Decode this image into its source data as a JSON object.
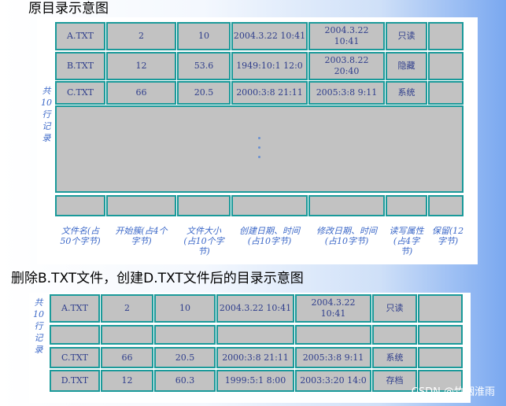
{
  "title_top": "原目录示意图",
  "title_bottom": "删除B.TXT文件，创建D.TXT文件后的目录示意图",
  "record_count_label": "共\n10\n行\n记\n录",
  "table1": {
    "rows": [
      [
        "A.TXT",
        "2",
        "10",
        "2004.3.22 10:41",
        "2004.3.22\n10:41",
        "只读",
        ""
      ],
      [
        "B.TXT",
        "12",
        "53.6",
        "1949:10:1 12:0",
        "2003.8.22\n20:40",
        "隐藏",
        ""
      ],
      [
        "C.TXT",
        "66",
        "20.5",
        "2000:3:8 21:11",
        "2005:3:8 9:11",
        "系统",
        ""
      ]
    ],
    "ellipsis": "…",
    "empty_row": [
      "",
      "",
      "",
      "",
      "",
      "",
      ""
    ],
    "captions": [
      "文件名(占\n50个字节)",
      "开始簇(占4个\n字节)",
      "文件大小\n(占10个字\n节)",
      "创建日期、时间\n(占10字节)",
      "修改日期、时间\n(占10字节)",
      "读写属性\n(占4字\n节)",
      "保留(12\n字节)"
    ]
  },
  "table2": {
    "rows": [
      [
        "A.TXT",
        "2",
        "10",
        "2004.3.22 10:41",
        "2004.3.22\n10:41",
        "只读",
        ""
      ],
      [
        "",
        "",
        "",
        "",
        "",
        "",
        ""
      ],
      [
        "C.TXT",
        "66",
        "20.5",
        "2000:3:8 21:11",
        "2005:3:8 9:11",
        "系统",
        ""
      ],
      [
        "D.TXT",
        "12",
        "60.3",
        "1999:5:1 8:00",
        "2003:3:20 14:0",
        "存档",
        ""
      ]
    ]
  },
  "watermark": "CSDN @竹烟淮雨",
  "colors": {
    "cell_fill": "#c2c2c2",
    "cell_border": "#1a9a9a",
    "cell_text": "#2f3e8c",
    "caption_text": "#3c68c8"
  }
}
